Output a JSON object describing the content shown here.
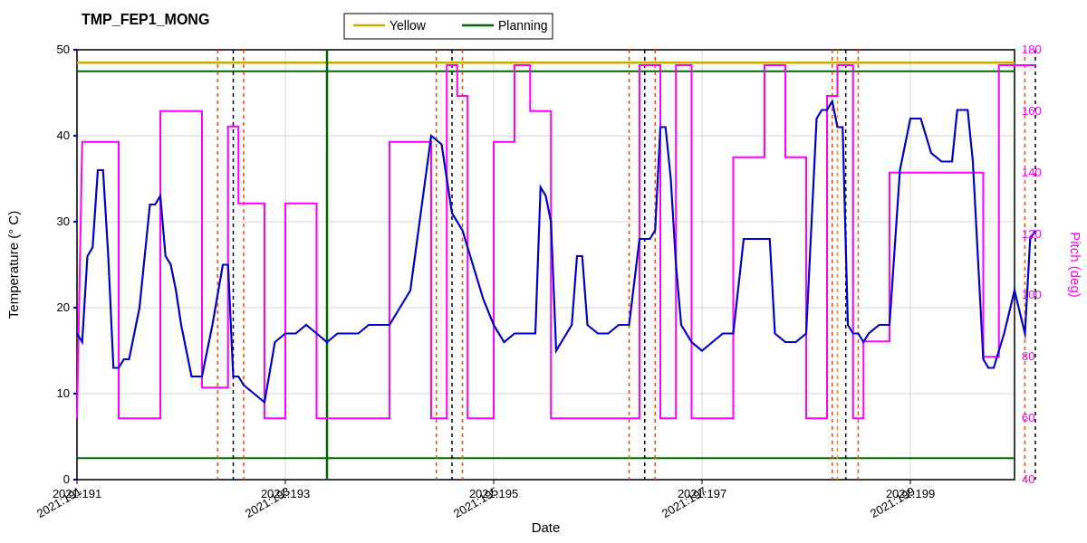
{
  "title": "TMP_FEP1_MONG",
  "legend": {
    "yellow_label": "Yellow",
    "planning_label": "Planning"
  },
  "axes": {
    "x_label": "Date",
    "y_left_label": "Temperature (° C)",
    "y_right_label": "Pitch (deg)",
    "x_ticks": [
      "2021:191",
      "2021:193",
      "2021:195",
      "2021:197",
      "2021:199"
    ],
    "y_left_min": 0,
    "y_left_max": 50,
    "y_right_min": 40,
    "y_right_max": 180
  },
  "colors": {
    "blue_line": "#0000cc",
    "magenta_line": "#ff00ff",
    "yellow_line": "#ffcc00",
    "green_line": "#008000",
    "red_dashed": "#ff4400",
    "black_dashed": "#000000",
    "orange_dashed": "#ff8800"
  }
}
